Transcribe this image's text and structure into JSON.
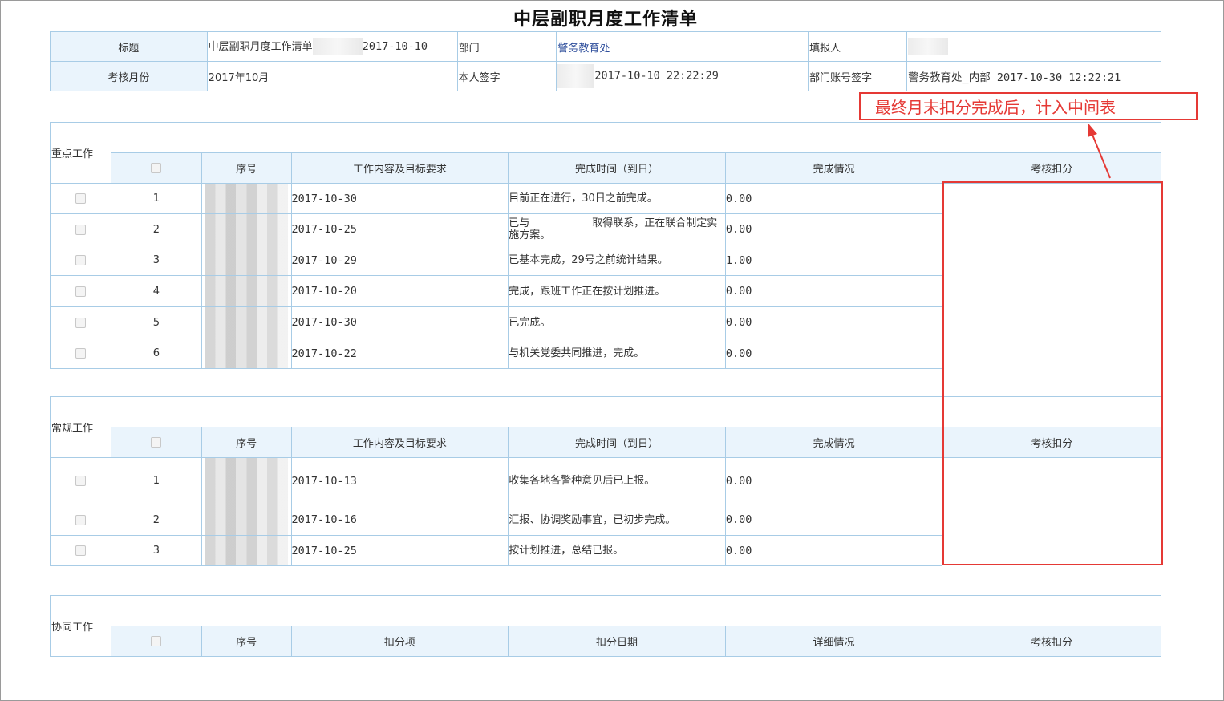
{
  "page": {
    "title": "中层副职月度工作清单"
  },
  "header": {
    "title_label": "标题",
    "title_value_prefix": "中层副职月度工作清单",
    "title_value_date": "2017-10-10",
    "dept_label": "部门",
    "dept_value": "警务教育处",
    "reporter_label": "填报人",
    "month_label": "考核月份",
    "month_value": "2017年10月",
    "self_sign_label": "本人签字",
    "self_sign_value": "2017-10-10 22:22:29",
    "dept_sign_label": "部门账号签字",
    "dept_sign_value": "警务教育处_内部 2017-10-30 12:22:21"
  },
  "columns": {
    "seq": "序号",
    "content": "工作内容及目标要求",
    "done_time": "完成时间（到日）",
    "status": "完成情况",
    "deduction": "考核扣分"
  },
  "key_work": {
    "label": "重点工作",
    "rows": [
      {
        "seq": "1",
        "date": "2017-10-30",
        "status": "目前正在进行，30日之前完成。",
        "score": "0.00"
      },
      {
        "seq": "2",
        "date": "2017-10-25",
        "status": "已与　　　　　　取得联系，正在联合制定实施方案。",
        "score": "0.00"
      },
      {
        "seq": "3",
        "date": "2017-10-29",
        "status": "已基本完成，29号之前统计结果。",
        "score": "1.00"
      },
      {
        "seq": "4",
        "date": "2017-10-20",
        "status": "完成，跟班工作正在按计划推进。",
        "score": "0.00"
      },
      {
        "seq": "5",
        "date": "2017-10-30",
        "status": "已完成。",
        "score": "0.00"
      },
      {
        "seq": "6",
        "date": "2017-10-22",
        "status": "与机关党委共同推进，完成。",
        "score": "0.00"
      }
    ]
  },
  "routine_work": {
    "label": "常规工作",
    "rows": [
      {
        "seq": "1",
        "date": "2017-10-13",
        "status": "收集各地各警种意见后已上报。",
        "score": "0.00"
      },
      {
        "seq": "2",
        "date": "2017-10-16",
        "status": "汇报、协调奖励事宜，已初步完成。",
        "score": "0.00"
      },
      {
        "seq": "3",
        "date": "2017-10-25",
        "status": "按计划推进，总结已报。",
        "score": "0.00"
      }
    ]
  },
  "collab_work": {
    "label": "协同工作",
    "columns": {
      "seq": "序号",
      "item": "扣分项",
      "date": "扣分日期",
      "detail": "详细情况",
      "deduction": "考核扣分"
    }
  },
  "annotation": {
    "text": "最终月末扣分完成后，计入中间表",
    "color": "#e53935"
  }
}
